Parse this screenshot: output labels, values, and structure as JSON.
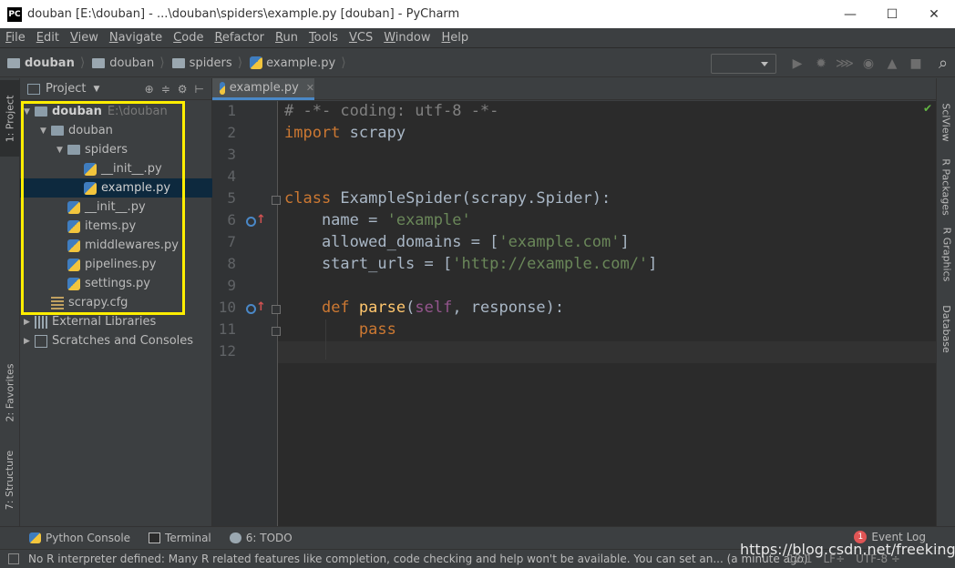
{
  "window": {
    "app_logo": "PC",
    "title": "douban [E:\\douban] - ...\\douban\\spiders\\example.py [douban] - PyCharm",
    "minimize": "—",
    "maximize": "☐",
    "close": "✕"
  },
  "menu": {
    "items": [
      {
        "u": "F",
        "rest": "ile"
      },
      {
        "u": "E",
        "rest": "dit"
      },
      {
        "u": "V",
        "rest": "iew"
      },
      {
        "u": "N",
        "rest": "avigate"
      },
      {
        "u": "C",
        "rest": "ode"
      },
      {
        "u": "R",
        "rest": "efactor"
      },
      {
        "u": "R",
        "rest": "un"
      },
      {
        "u": "T",
        "rest": "ools"
      },
      {
        "u": "V",
        "rest": "CS"
      },
      {
        "u": "W",
        "rest": "indow"
      },
      {
        "u": "H",
        "rest": "elp"
      }
    ]
  },
  "breadcrumb": {
    "items": [
      "douban",
      "douban",
      "spiders",
      "example.py"
    ]
  },
  "toolbar": {
    "run_icon": "▶",
    "debug_icon": "✹",
    "coverage_icon": "⋙",
    "profile_icon": "◉",
    "concurrency_icon": "▲",
    "stop_icon": "■",
    "search_icon": "⌕"
  },
  "left_tabs": {
    "project": "1: Project",
    "favorites": "2: Favorites",
    "structure": "7: Structure"
  },
  "project_panel": {
    "title": "Project",
    "caret": "▼",
    "icons": [
      "⊕",
      "≑",
      "⚙",
      "⊢"
    ]
  },
  "tree": [
    {
      "label": "douban",
      "suffix": "E:\\douban",
      "tri": "▼",
      "icon": "folder",
      "bold": true
    },
    {
      "label": "douban",
      "suffix": "",
      "tri": "▼",
      "icon": "folder"
    },
    {
      "label": "spiders",
      "suffix": "",
      "tri": "▼",
      "icon": "folder"
    },
    {
      "label": "__init__.py",
      "suffix": "",
      "tri": "",
      "icon": "py"
    },
    {
      "label": "example.py",
      "suffix": "",
      "tri": "",
      "icon": "py",
      "selected": true
    },
    {
      "label": "__init__.py",
      "suffix": "",
      "tri": "",
      "icon": "py"
    },
    {
      "label": "items.py",
      "suffix": "",
      "tri": "",
      "icon": "py"
    },
    {
      "label": "middlewares.py",
      "suffix": "",
      "tri": "",
      "icon": "py"
    },
    {
      "label": "pipelines.py",
      "suffix": "",
      "tri": "",
      "icon": "py"
    },
    {
      "label": "settings.py",
      "suffix": "",
      "tri": "",
      "icon": "py"
    },
    {
      "label": "scrapy.cfg",
      "suffix": "",
      "tri": "",
      "icon": "cfg"
    },
    {
      "label": "External Libraries",
      "suffix": "",
      "tri": "▶",
      "icon": "lib"
    },
    {
      "label": "Scratches and Consoles",
      "suffix": "",
      "tri": "▶",
      "icon": "scratch"
    }
  ],
  "editor": {
    "tab_label": "example.py",
    "tab_close": "✕",
    "line_numbers": [
      "1",
      "2",
      "3",
      "4",
      "5",
      "6",
      "7",
      "8",
      "9",
      "10",
      "11",
      "12"
    ],
    "lines": [
      [
        {
          "t": "# -*- coding: utf-8 -*-",
          "c": "comment"
        }
      ],
      [
        {
          "t": "import",
          "c": "kw"
        },
        {
          "t": " scrapy",
          "c": ""
        }
      ],
      [],
      [],
      [
        {
          "t": "class",
          "c": "kw"
        },
        {
          "t": " ExampleSpider(scrapy.Spider):",
          "c": ""
        }
      ],
      [
        {
          "t": "    name = ",
          "c": ""
        },
        {
          "t": "'example'",
          "c": "str"
        }
      ],
      [
        {
          "t": "    allowed_domains = [",
          "c": ""
        },
        {
          "t": "'example.com'",
          "c": "str"
        },
        {
          "t": "]",
          "c": ""
        }
      ],
      [
        {
          "t": "    start_urls = [",
          "c": ""
        },
        {
          "t": "'http://example.com/'",
          "c": "str"
        },
        {
          "t": "]",
          "c": ""
        }
      ],
      [],
      [
        {
          "t": "    ",
          "c": ""
        },
        {
          "t": "def",
          "c": "kw"
        },
        {
          "t": " ",
          "c": ""
        },
        {
          "t": "parse",
          "c": "fn"
        },
        {
          "t": "(",
          "c": ""
        },
        {
          "t": "self",
          "c": "self"
        },
        {
          "t": ", response):",
          "c": ""
        }
      ],
      [
        {
          "t": "        ",
          "c": ""
        },
        {
          "t": "pass",
          "c": "kw"
        }
      ],
      []
    ],
    "check": "✔"
  },
  "right_tabs": [
    "SciView",
    "R Packages",
    "R Graphics",
    "Database"
  ],
  "bottom_tools": {
    "python_console": "Python Console",
    "terminal": "Terminal",
    "todo": "6: TODO",
    "event_log": "Event Log",
    "event_count": "1"
  },
  "status": {
    "message": "No R interpreter defined: Many R related features like completion, code checking and help won't be available. You can set an... (a minute ago)",
    "position": "12:1",
    "line_sep": "LF÷",
    "encoding": "UTF-8 ÷"
  },
  "watermark": "https://blog.csdn.net/freeking101",
  "colors": {
    "background": "#3c3f41",
    "editor": "#2b2b2b",
    "keyword": "#cc7832",
    "string": "#6a8759",
    "highlight_box": "#ffee00"
  }
}
